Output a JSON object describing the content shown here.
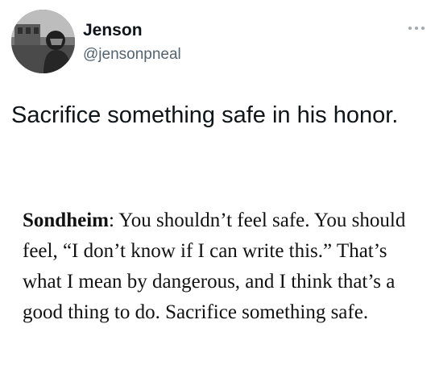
{
  "author": {
    "name": "Jenson",
    "handle": "@jensonpneal"
  },
  "menu": {
    "icon": "more-horizontal-icon"
  },
  "tweet": {
    "text": "Sacrifice something safe in his honor."
  },
  "quote": {
    "speaker": "Sondheim",
    "separator": ":",
    "body": " You shouldn’t feel safe. You should feel, “I don’t know if I can write this.” That’s what I mean by dangerous, and I think that’s a good thing to do. Sacrifice something safe."
  },
  "colors": {
    "text": "#0f1419",
    "secondary": "#536471",
    "background": "#ffffff"
  }
}
